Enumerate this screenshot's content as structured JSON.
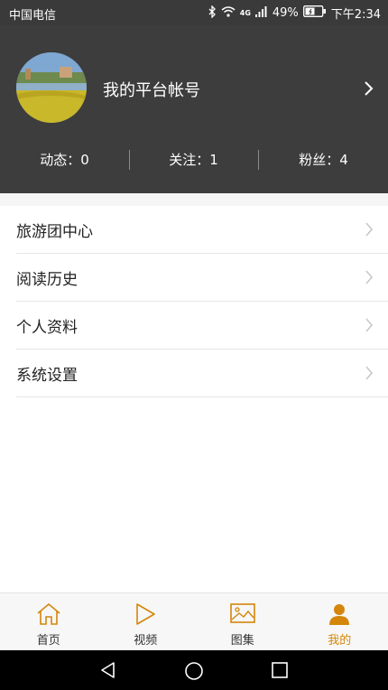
{
  "status_bar": {
    "carrier": "中国电信",
    "network_label": "4G",
    "battery_percent": "49%",
    "time": "下午2:34"
  },
  "profile": {
    "account_name": "我的平台帐号",
    "stats": {
      "dynamics": "动态：0",
      "following": "关注：1",
      "fans": "粉丝：4"
    }
  },
  "menu": {
    "items": [
      {
        "label": "旅游团中心"
      },
      {
        "label": "阅读历史"
      },
      {
        "label": "个人资料"
      },
      {
        "label": "系统设置"
      }
    ]
  },
  "tabbar": {
    "tabs": [
      {
        "label": "首页",
        "icon": "home-icon"
      },
      {
        "label": "视频",
        "icon": "play-icon"
      },
      {
        "label": "图集",
        "icon": "image-icon"
      },
      {
        "label": "我的",
        "icon": "user-icon",
        "active": true
      }
    ],
    "accent_color": "#d4860a"
  }
}
